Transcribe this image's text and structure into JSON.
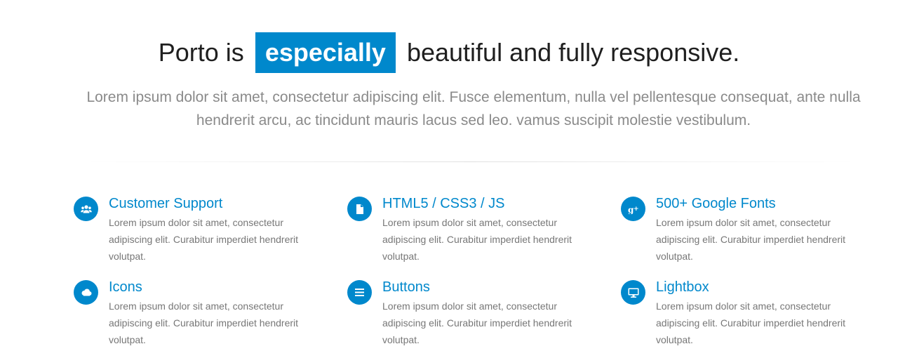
{
  "hero": {
    "headline_prefix": "Porto is",
    "headline_highlight": "especially",
    "headline_suffix": "beautiful and fully responsive.",
    "lead": "Lorem ipsum dolor sit amet, consectetur adipiscing elit. Fusce elementum, nulla vel pellentesque consequat, ante nulla hendrerit arcu, ac tincidunt mauris lacus sed leo. vamus suscipit molestie vestibulum."
  },
  "colors": {
    "accent": "#0088cc",
    "text": "#777777",
    "heading": "#1f1f1f"
  },
  "features": [
    {
      "title": "Customer Support",
      "icon": "users-icon",
      "description": "Lorem ipsum dolor sit amet, consectetur adipiscing elit. Curabitur imperdiet hendrerit volutpat."
    },
    {
      "title": "HTML5 / CSS3 / JS",
      "icon": "file-icon",
      "description": "Lorem ipsum dolor sit amet, consectetur adipiscing elit. Curabitur imperdiet hendrerit volutpat."
    },
    {
      "title": "500+ Google Fonts",
      "icon": "google-plus-icon",
      "description": "Lorem ipsum dolor sit amet, consectetur adipiscing elit. Curabitur imperdiet hendrerit volutpat."
    },
    {
      "title": "Icons",
      "icon": "cloud-icon",
      "description": "Lorem ipsum dolor sit amet, consectetur adipiscing elit. Curabitur imperdiet hendrerit volutpat."
    },
    {
      "title": "Buttons",
      "icon": "bars-icon",
      "description": "Lorem ipsum dolor sit amet, consectetur adipiscing elit. Curabitur imperdiet hendrerit volutpat."
    },
    {
      "title": "Lightbox",
      "icon": "desktop-icon",
      "description": "Lorem ipsum dolor sit amet, consectetur adipiscing elit. Curabitur imperdiet hendrerit volutpat."
    }
  ]
}
